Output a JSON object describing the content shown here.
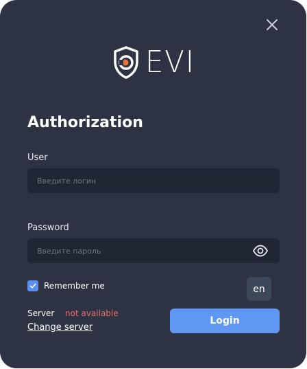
{
  "logo": {
    "text": "EVI",
    "icon": "shield-eye-icon",
    "accent_color": "#e8743b"
  },
  "window": {
    "close_icon": "close-icon"
  },
  "form": {
    "title": "Authorization",
    "user": {
      "label": "User",
      "placeholder": "Введите логин",
      "value": ""
    },
    "password": {
      "label": "Password",
      "placeholder": "Введите пароль",
      "value": "",
      "toggle_icon": "eye-icon"
    },
    "remember": {
      "label": "Remember me",
      "checked": true
    },
    "language": "en",
    "server": {
      "label": "Server",
      "status": "not available",
      "status_color": "#e86d6d",
      "change_label": "Change server"
    },
    "login_label": "Login"
  },
  "colors": {
    "background": "#2d3342",
    "input_background": "#202634",
    "primary": "#5f97f2"
  }
}
